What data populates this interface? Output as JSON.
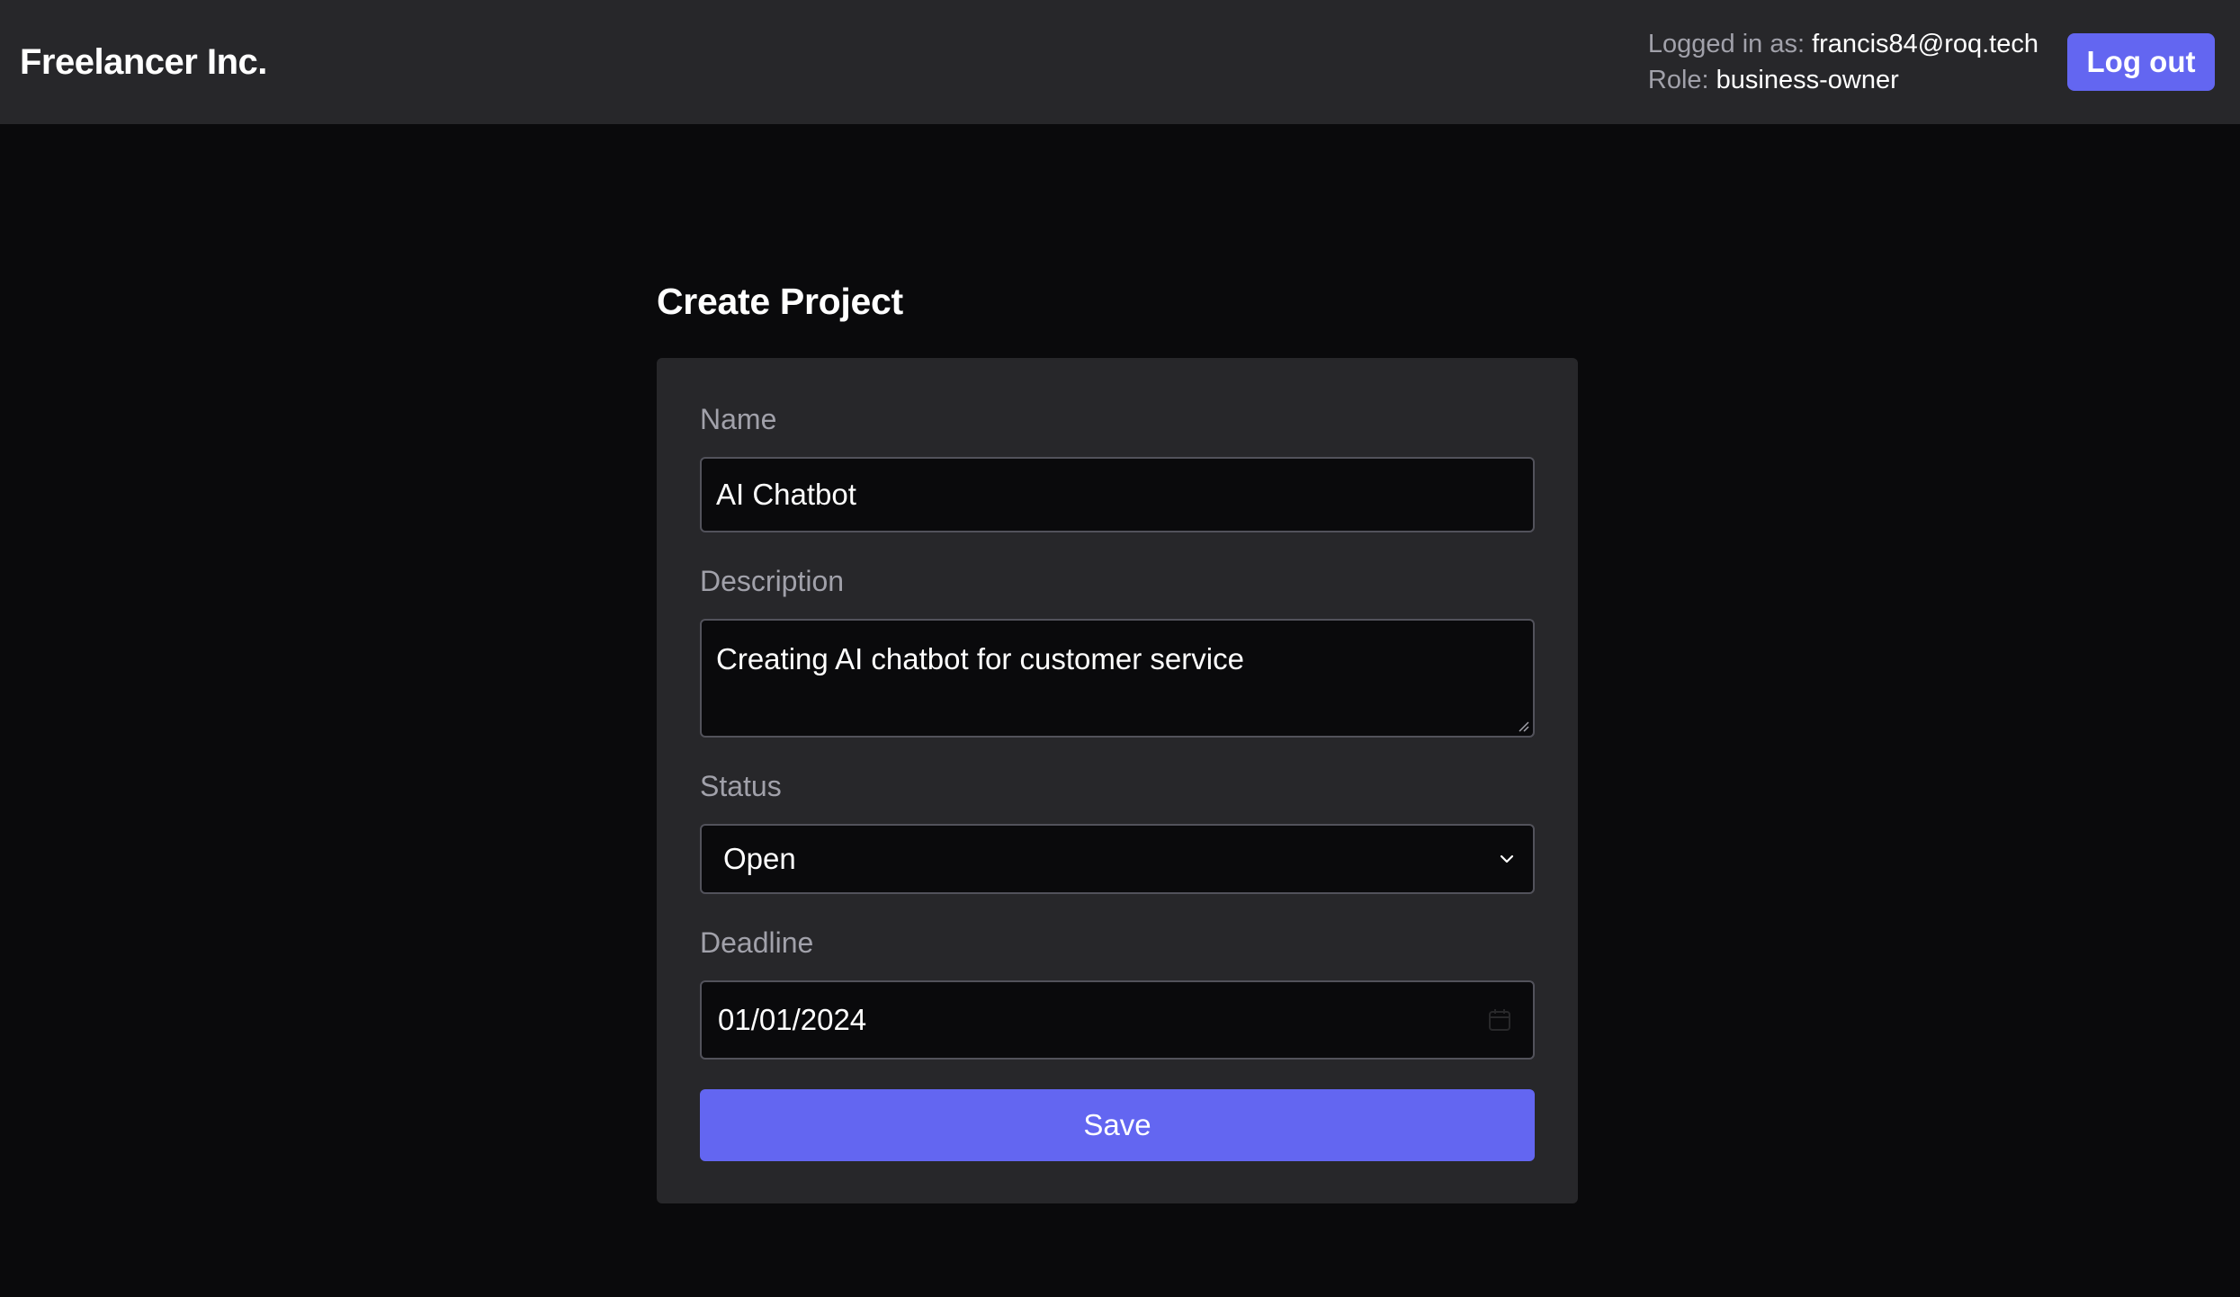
{
  "header": {
    "brand": "Freelancer Inc.",
    "logged_in_label": "Logged in as:",
    "email": "francis84@roq.tech",
    "role_label": "Role:",
    "role": "business-owner",
    "logout_label": "Log out"
  },
  "page": {
    "title": "Create Project"
  },
  "form": {
    "name": {
      "label": "Name",
      "value": "AI Chatbot"
    },
    "description": {
      "label": "Description",
      "value": "Creating AI chatbot for customer service"
    },
    "status": {
      "label": "Status",
      "selected": "Open"
    },
    "deadline": {
      "label": "Deadline",
      "value": "01/01/2024"
    },
    "save_label": "Save"
  },
  "icons": {
    "status_dropdown": "chevron-down-icon",
    "deadline_picker": "calendar-icon",
    "textarea_resize": "resize-grip-icon"
  },
  "colors": {
    "accent": "#6366f1",
    "header_bg": "#27272a",
    "page_bg": "#0a0a0c",
    "card_bg": "#27272a",
    "input_bg": "#0a0a0c",
    "muted_text": "#a1a1aa"
  }
}
